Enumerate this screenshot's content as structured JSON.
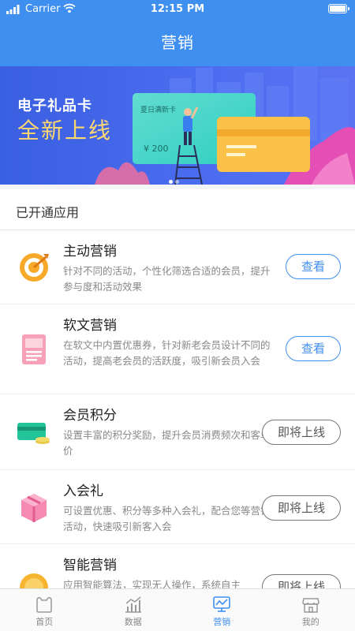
{
  "status_bar": {
    "carrier": "Carrier",
    "time": "12:15 PM"
  },
  "header": {
    "title": "营销"
  },
  "banner": {
    "title": "电子礼品卡",
    "subtitle": "全新上线",
    "card_label": "夏日满新卡",
    "card_amount": "¥ 200"
  },
  "section": {
    "title": "已开通应用"
  },
  "apps": [
    {
      "name": "主动营销",
      "desc": "针对不同的活动，个性化筛选合适的会员，提升参与度和活动效果",
      "button": "查看",
      "icon": "target-icon"
    },
    {
      "name": "软文营销",
      "desc": "在软文中内置优惠券，针对新老会员设计不同的活动，提高老会员的活跃度，吸引新会员入会",
      "button": "查看",
      "icon": "document-icon"
    },
    {
      "name": "会员积分",
      "desc": "设置丰富的积分奖励，提升会员消费频次和客单价",
      "button": "即将上线",
      "icon": "card-coins-icon"
    },
    {
      "name": "入会礼",
      "desc": "可设置优惠、积分等多种入会礼，配合您等营销活动，快速吸引新客入会",
      "button": "即将上线",
      "icon": "gift-icon"
    },
    {
      "name": "智能营销",
      "desc": "应用智能算法，实现无人操作，系统自主",
      "button": "即将上线",
      "icon": "smart-icon"
    }
  ],
  "tabs": [
    {
      "label": "首页",
      "icon": "home-icon"
    },
    {
      "label": "数据",
      "icon": "chart-icon"
    },
    {
      "label": "营销",
      "icon": "marketing-icon"
    },
    {
      "label": "我的",
      "icon": "store-icon"
    }
  ],
  "colors": {
    "primary": "#3f8ff0",
    "banner": "#4c6df0",
    "accent": "#ffd86e"
  }
}
